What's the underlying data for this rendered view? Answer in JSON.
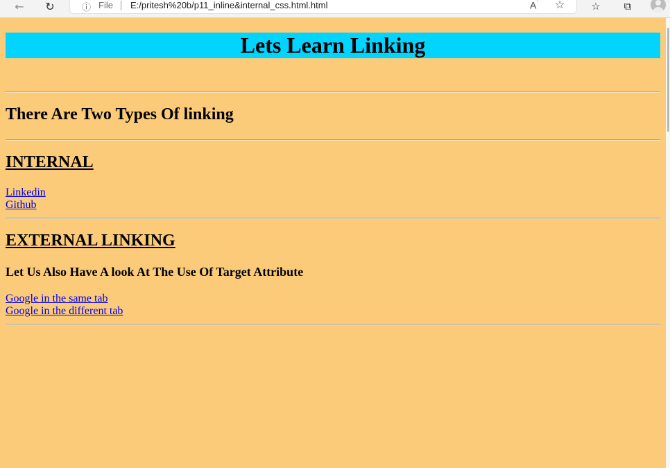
{
  "browser": {
    "back_icon": "back-arrow-icon",
    "refresh_icon": "refresh-icon",
    "info_icon": "info-icon",
    "file_label": "File",
    "url": "E:/pritesh%20b/p11_inline&internal_css.html.html",
    "read_aloud_label": "Aʹ",
    "toolbar_icons": [
      "add-favorite-icon",
      "favorites-icon",
      "collections-icon",
      "profile-avatar-icon"
    ]
  },
  "page": {
    "background": "#fbcb7a",
    "title_background": "#00d4ff",
    "title": "Lets Learn Linking",
    "types_heading": "There Are Two Types Of linking",
    "internal_heading": "INTERNAL",
    "internal_links": [
      "Linkedin",
      "Github"
    ],
    "external_heading": "EXTERNAL LINKING",
    "target_heading": "Let Us Also Have A look At The Use Of Target Attribute",
    "external_links": [
      "Google in the same tab",
      "Google in the different tab"
    ]
  }
}
